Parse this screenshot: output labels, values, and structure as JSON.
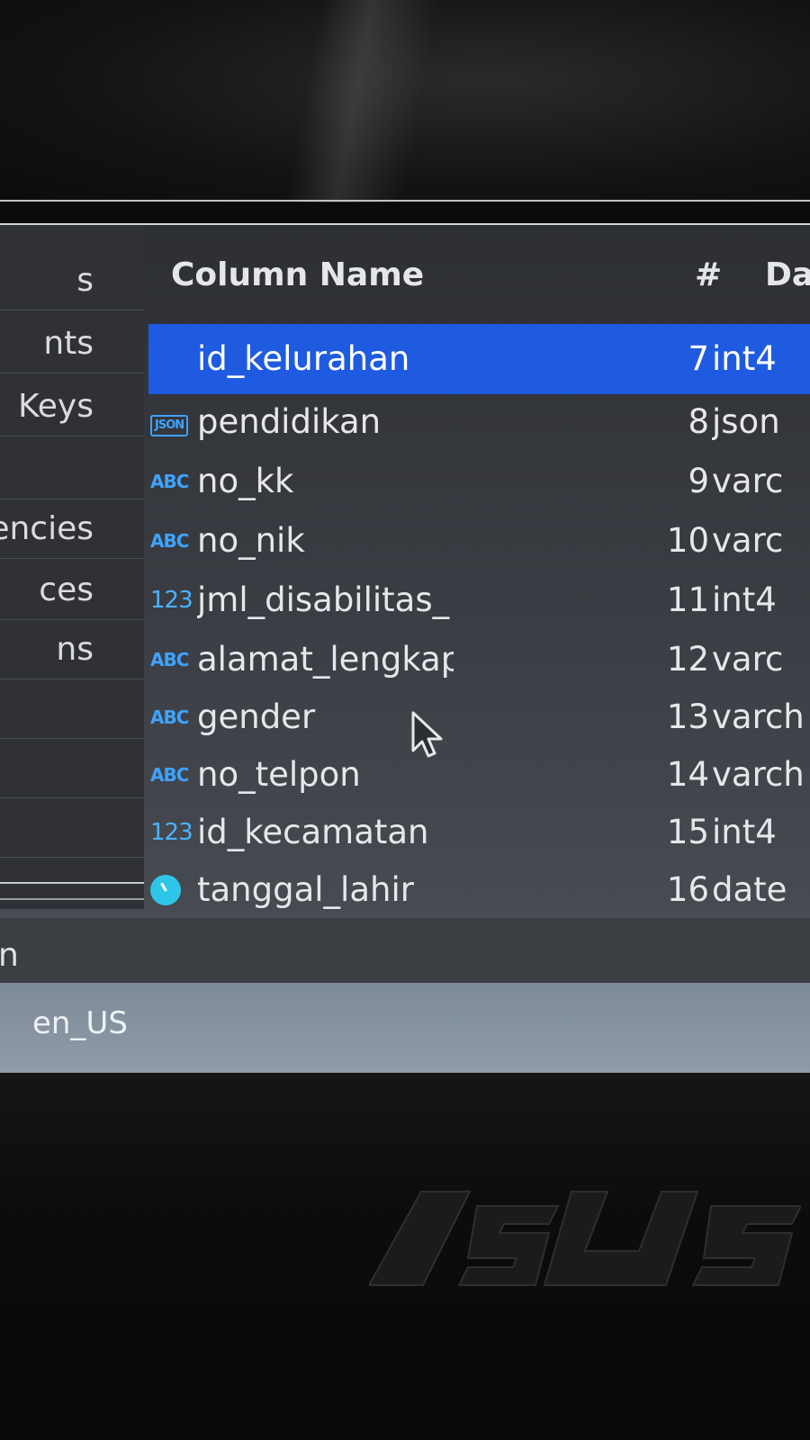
{
  "left_nav": {
    "items": [
      "s",
      "nts",
      "Keys",
      "",
      "encies",
      "ces",
      "ns",
      "",
      "",
      ""
    ]
  },
  "table": {
    "headers": {
      "column_name": "Column Name",
      "number": "#",
      "data_type": "Da"
    },
    "rows": [
      {
        "icon": "",
        "name": "id_kelurahan",
        "num": "7",
        "type": "int4",
        "selected": true
      },
      {
        "icon": "JSON",
        "name": "pendidikan",
        "num": "8",
        "type": "json"
      },
      {
        "icon": "ABC",
        "name": "no_kk",
        "num": "9",
        "type": "varc"
      },
      {
        "icon": "ABC",
        "name": "no_nik",
        "num": "10",
        "type": "varc"
      },
      {
        "icon": "123",
        "name": "jml_disabilitas_",
        "num": "11",
        "type": "int4"
      },
      {
        "icon": "ABC",
        "name": "alamat_lengkap",
        "num": "12",
        "type": "varc"
      },
      {
        "icon": "ABC",
        "name": "gender",
        "num": "13",
        "type": "varch"
      },
      {
        "icon": "ABC",
        "name": "no_telpon",
        "num": "14",
        "type": "varch"
      },
      {
        "icon": "123",
        "name": "id_kecamatan",
        "num": "15",
        "type": "int4"
      },
      {
        "icon": "clock",
        "name": "tanggal_lahir",
        "num": "16",
        "type": "date"
      }
    ]
  },
  "status": {
    "partial_text": "n"
  },
  "locale": {
    "value": "en_US"
  },
  "colors": {
    "selection": "#1e5be0",
    "icon_blue": "#3fa2ff",
    "clock_icon": "#2ec6e8"
  }
}
